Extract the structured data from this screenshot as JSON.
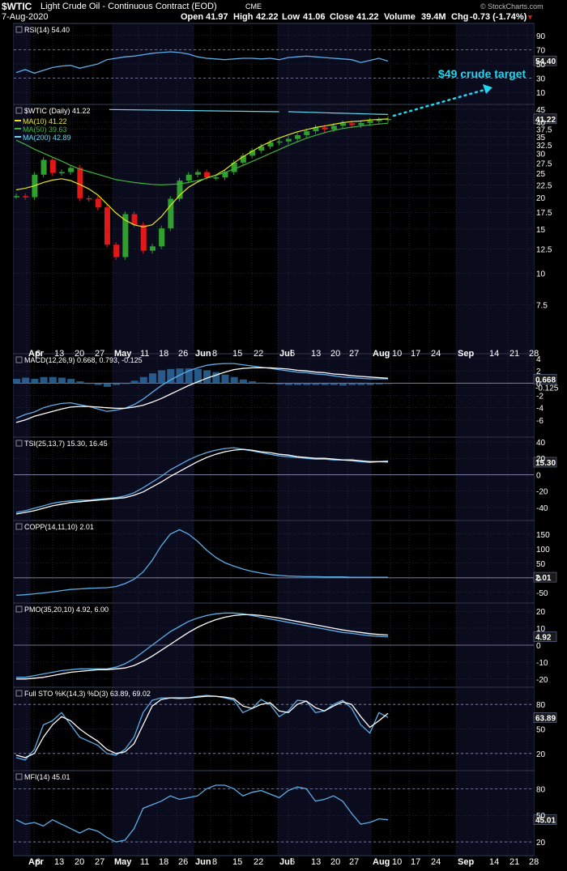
{
  "header": {
    "symbol": "$WTIC",
    "title": "Light Crude Oil - Continuous Contract (EOD)",
    "exchange": "CME",
    "date": "7-Aug-2020",
    "open_label": "Open",
    "open": "41.97",
    "high_label": "High",
    "high": "42.22",
    "low_label": "Low",
    "low": "41.06",
    "close_label": "Close",
    "close": "41.22",
    "volume_label": "Volume",
    "volume": "39.4M",
    "chg_label": "Chg",
    "chg": "-0.73 (-1.74%)",
    "watermark": "© StockCharts.com"
  },
  "annotation": "$49 crude target",
  "colors": {
    "background": "#000000",
    "panel_odd": "#0b0b1e",
    "grid": "#3a4060",
    "line": "#5aaee8",
    "signal": "#ffffff",
    "ma10": "#e6e61e",
    "ma50": "#3cb43c",
    "ma200": "#64d8f0",
    "up": "#2ea02e",
    "down": "#e01818",
    "annotation": "#20d8f0"
  },
  "chart_data": {
    "type": "line",
    "x_ticks": [
      "Apr",
      "6",
      "13",
      "20",
      "27",
      "May",
      "11",
      "18",
      "26",
      "Jun",
      "8",
      "15",
      "22",
      "Jul",
      "6",
      "13",
      "20",
      "27",
      "Aug",
      "10",
      "17",
      "24",
      "Sep",
      "14",
      "21",
      "28"
    ],
    "panels": [
      {
        "id": "rsi",
        "legend": "RSI(14) 54.40",
        "ylim": [
          0,
          100
        ],
        "y_ticks": [
          10,
          30,
          50,
          70,
          90
        ],
        "last_label": "54.40",
        "levels": [
          70,
          30
        ],
        "series": [
          {
            "name": "RSI(14)",
            "color": "#5aaee8",
            "values": [
              38,
              42,
              37,
              41,
              45,
              47,
              48,
              44,
              47,
              50,
              56,
              58,
              60,
              61,
              63,
              65,
              66,
              67,
              66,
              64,
              60,
              58,
              57,
              56,
              57,
              58,
              58,
              57,
              58,
              56,
              59,
              60,
              61,
              60,
              59,
              58,
              57,
              56,
              52,
              55,
              58,
              54
            ]
          }
        ]
      },
      {
        "id": "price",
        "legend": "$WTIC (Daily) 41.22",
        "ylim": [
          5,
          45
        ],
        "log": true,
        "y_ticks": [
          7.5,
          10,
          12.5,
          15,
          17.5,
          20,
          22.5,
          25,
          27.5,
          30,
          32.5,
          35,
          37.5,
          40,
          45
        ],
        "last_label": "41.22",
        "legends": [
          "MA(10) 41.22",
          "MA(50) 39.63",
          "MA(200) 42.89"
        ],
        "series": [
          {
            "name": "$WTIC (Daily)",
            "color": "#e01818",
            "values": [
              20.3,
              20.1,
              24.7,
              28.3,
              25.1,
              25.3,
              26.3,
              19.9,
              19.8,
              18.3,
              13.0,
              11.6,
              17.2,
              15.6,
              12.3,
              12.8,
              15.1,
              19.8,
              23.4,
              24.7,
              25.3,
              24.1,
              24.1,
              25.3,
              27.6,
              29.4,
              30.8,
              32.0,
              33.2,
              33.5,
              34.3,
              35.5,
              36.8,
              38.1,
              37.4,
              38.7,
              39.6,
              38.9,
              39.7,
              40.5,
              40.8,
              41.2
            ]
          },
          {
            "name": "MA(10)",
            "color": "#e6e61e",
            "values": [
              21.5,
              21.8,
              22.3,
              23.0,
              23.5,
              23.8,
              23.4,
              22.6,
              21.7,
              20.5,
              18.9,
              17.4,
              16.3,
              15.6,
              15.3,
              15.6,
              16.8,
              18.6,
              20.4,
              22.0,
              23.1,
              24.0,
              24.6,
              25.8,
              27.5,
              29.1,
              30.6,
              32.1,
              33.4,
              34.6,
              35.6,
              36.6,
              37.3,
              38.1,
              38.6,
              39.2,
              39.8,
              40.2,
              40.4,
              40.8,
              41.0,
              41.2
            ]
          },
          {
            "name": "MA(50)",
            "color": "#3cb43c",
            "values": [
              33.9,
              32.6,
              31.2,
              30.1,
              29.0,
              28.0,
              26.9,
              26.0,
              25.4,
              24.8,
              24.2,
              23.6,
              23.3,
              23.0,
              22.8,
              22.6,
              22.5,
              22.6,
              22.7,
              23.0,
              23.4,
              23.9,
              24.5,
              25.2,
              26.0,
              26.9,
              27.9,
              28.9,
              30.0,
              31.1,
              32.3,
              33.4,
              34.5,
              35.4,
              36.3,
              37.1,
              37.7,
              38.2,
              38.6,
              39.0,
              39.3,
              39.6
            ]
          },
          {
            "name": "MA(200)",
            "color": "#64d8f0",
            "values": [
              null,
              null,
              null,
              null,
              null,
              null,
              null,
              null,
              null,
              null,
              null,
              null,
              null,
              null,
              null,
              null,
              null,
              null,
              null,
              null,
              null,
              null,
              null,
              null,
              null,
              null,
              null,
              null,
              null,
              null,
              44.0,
              43.9,
              43.8,
              43.7,
              43.6,
              43.5,
              43.4,
              43.3,
              43.2,
              43.1,
              43.0,
              42.9
            ]
          }
        ]
      },
      {
        "id": "macd",
        "legend": "MACD(12,26,9) 0.668, 0.793, -0.125",
        "ylim": [
          -8,
          4
        ],
        "y_ticks": [
          -6,
          -4,
          -2,
          0,
          2,
          4
        ],
        "last_label": "0.668",
        "last_label2": "-0.125",
        "series": [
          {
            "name": "MACD",
            "color": "#5aaee8",
            "values": [
              -5.7,
              -5.1,
              -4.7,
              -4.0,
              -3.6,
              -3.3,
              -3.2,
              -3.5,
              -3.8,
              -4.2,
              -4.6,
              -4.4,
              -4.1,
              -3.5,
              -2.6,
              -1.5,
              -0.4,
              0.5,
              1.3,
              2.0,
              2.5,
              2.9,
              3.1,
              3.2,
              3.2,
              3.0,
              2.8,
              2.6,
              2.4,
              2.2,
              2.0,
              1.8,
              1.7,
              1.5,
              1.4,
              1.2,
              1.0,
              0.9,
              0.8,
              0.7,
              0.7,
              0.7
            ]
          },
          {
            "name": "Signal",
            "color": "#ffffff",
            "values": [
              -6.4,
              -6.0,
              -5.4,
              -5.0,
              -4.6,
              -4.2,
              -3.9,
              -3.8,
              -3.8,
              -3.9,
              -4.0,
              -4.1,
              -4.1,
              -3.9,
              -3.6,
              -3.1,
              -2.5,
              -1.8,
              -1.1,
              -0.4,
              0.2,
              0.8,
              1.3,
              1.8,
              2.2,
              2.4,
              2.5,
              2.5,
              2.5,
              2.4,
              2.3,
              2.1,
              2.0,
              1.8,
              1.7,
              1.5,
              1.4,
              1.2,
              1.1,
              1.0,
              0.9,
              0.8
            ]
          }
        ]
      },
      {
        "id": "tsi",
        "legend": "TSI(25,13,7) 15.30, 16.45",
        "ylim": [
          -50,
          40
        ],
        "y_ticks": [
          -40,
          -20,
          0,
          20,
          40
        ],
        "last_label": "15.30",
        "series": [
          {
            "name": "TSI",
            "color": "#5aaee8",
            "values": [
              -46,
              -44,
              -41,
              -38,
              -35,
              -33,
              -32,
              -31,
              -31,
              -30,
              -29,
              -28,
              -26,
              -22,
              -16,
              -9,
              -2,
              6,
              12,
              18,
              23,
              27,
              30,
              32,
              33,
              31,
              29,
              27,
              25,
              23,
              22,
              21,
              20,
              19,
              19,
              18,
              18,
              17,
              16,
              15,
              16,
              15.3
            ]
          },
          {
            "name": "Signal",
            "color": "#ffffff",
            "values": [
              -48,
              -46,
              -44,
              -41,
              -38,
              -36,
              -34,
              -33,
              -32,
              -31,
              -30,
              -29,
              -28,
              -25,
              -21,
              -15,
              -9,
              -2,
              4,
              10,
              16,
              21,
              25,
              28,
              30,
              31,
              30,
              28,
              27,
              25,
              24,
              22,
              21,
              20,
              20,
              19,
              18,
              18,
              17,
              16,
              16,
              16.45
            ]
          }
        ]
      },
      {
        "id": "copp",
        "legend": "COPP(14,11,10) 2.01",
        "ylim": [
          -70,
          180
        ],
        "y_ticks": [
          -50,
          0,
          50,
          100,
          150
        ],
        "last_label": "2.01",
        "series": [
          {
            "name": "COPP",
            "color": "#5aaee8",
            "values": [
              -60,
              -58,
              -55,
              -52,
              -48,
              -44,
              -40,
              -38,
              -36,
              -35,
              -34,
              -30,
              -20,
              -5,
              20,
              60,
              110,
              150,
              165,
              150,
              125,
              95,
              70,
              52,
              40,
              30,
              22,
              16,
              11,
              8,
              6,
              5,
              4,
              4,
              3,
              3,
              3,
              2,
              2,
              2,
              2,
              2.01
            ]
          }
        ]
      },
      {
        "id": "pmo",
        "legend": "PMO(35,20,10) 4.92, 6.00",
        "ylim": [
          -22,
          22
        ],
        "y_ticks": [
          -20,
          -10,
          0,
          10,
          20
        ],
        "last_label": "4.92",
        "series": [
          {
            "name": "PMO",
            "color": "#5aaee8",
            "values": [
              -19,
              -19,
              -18,
              -17,
              -16,
              -15,
              -14.5,
              -14,
              -14,
              -14,
              -14,
              -13,
              -11,
              -8,
              -4,
              0,
              4,
              8,
              11,
              14,
              16,
              17.5,
              18.5,
              19,
              19,
              18.5,
              17.5,
              16.5,
              15.5,
              14.5,
              13.5,
              12.5,
              11.5,
              10.5,
              9.5,
              8.5,
              7.5,
              7,
              6.2,
              5.6,
              5.2,
              4.92
            ]
          },
          {
            "name": "Signal",
            "color": "#ffffff",
            "values": [
              -20,
              -20,
              -19.5,
              -19,
              -18,
              -17,
              -16,
              -15.5,
              -15,
              -14.5,
              -14.5,
              -14,
              -13.5,
              -12,
              -9.5,
              -6.5,
              -3,
              0.5,
              4,
              7.5,
              10.5,
              13,
              15,
              16.5,
              17.5,
              18,
              18,
              17.5,
              16.8,
              16,
              15,
              14,
              13,
              12,
              11,
              10,
              9,
              8.2,
              7.5,
              6.8,
              6.3,
              6.0
            ]
          }
        ]
      },
      {
        "id": "sto",
        "legend": "Full STO %K(14,3) %D(3) 63.89, 69.02",
        "ylim": [
          5,
          95
        ],
        "y_ticks": [
          20,
          50,
          80
        ],
        "last_label": "63.89",
        "levels": [
          80,
          20
        ],
        "series": [
          {
            "name": "%K",
            "color": "#5aaee8",
            "values": [
              15,
              12,
              25,
              55,
              60,
              70,
              55,
              40,
              35,
              30,
              20,
              18,
              25,
              40,
              70,
              85,
              88,
              88,
              87,
              88,
              90,
              91,
              90,
              88,
              85,
              70,
              75,
              86,
              80,
              65,
              72,
              85,
              84,
              70,
              72,
              80,
              85,
              75,
              55,
              45,
              70,
              64
            ]
          },
          {
            "name": "%D",
            "color": "#ffffff",
            "values": [
              18,
              15,
              20,
              40,
              55,
              65,
              60,
              50,
              42,
              35,
              25,
              20,
              22,
              32,
              55,
              78,
              86,
              88,
              88,
              88,
              89,
              90,
              90,
              89,
              87,
              78,
              75,
              80,
              82,
              72,
              70,
              80,
              84,
              76,
              72,
              78,
              83,
              80,
              65,
              52,
              60,
              69
            ]
          }
        ]
      },
      {
        "id": "mfi",
        "legend": "MFI(14) 45.01",
        "ylim": [
          10,
          95
        ],
        "y_ticks": [
          20,
          50,
          80
        ],
        "last_label": "45.01",
        "levels": [
          80,
          20
        ],
        "series": [
          {
            "name": "MFI(14)",
            "color": "#5aaee8",
            "values": [
              45,
              40,
              42,
              38,
              45,
              40,
              35,
              30,
              35,
              32,
              25,
              20,
              22,
              35,
              58,
              62,
              66,
              72,
              68,
              70,
              72,
              80,
              84,
              84,
              80,
              72,
              76,
              78,
              74,
              70,
              78,
              82,
              80,
              66,
              68,
              72,
              66,
              52,
              40,
              42,
              46,
              45
            ]
          }
        ]
      }
    ]
  }
}
